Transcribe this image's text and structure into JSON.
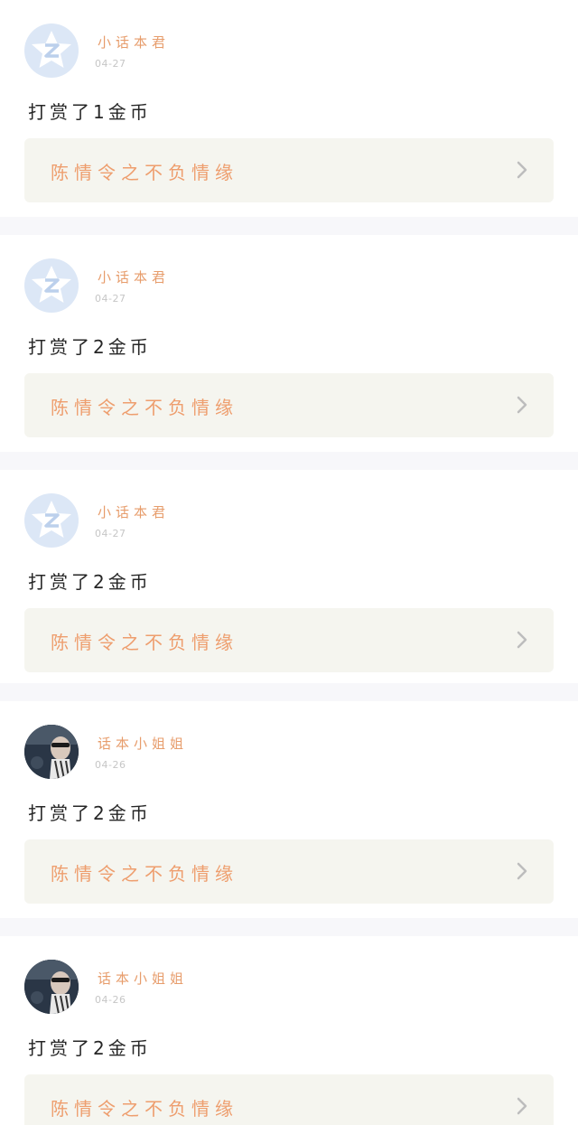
{
  "entries": [
    {
      "username": "小话本君",
      "date": "04-27",
      "message": "打赏了1金币",
      "book_title": "陈情令之不负情缘",
      "avatar_icon": "qq-default-avatar-icon"
    },
    {
      "username": "小话本君",
      "date": "04-27",
      "message": "打赏了2金币",
      "book_title": "陈情令之不负情缘",
      "avatar_icon": "qq-default-avatar-icon"
    },
    {
      "username": "小话本君",
      "date": "04-27",
      "message": "打赏了2金币",
      "book_title": "陈情令之不负情缘",
      "avatar_icon": "qq-default-avatar-icon"
    },
    {
      "username": "话本小姐姐",
      "date": "04-26",
      "message": "打赏了2金币",
      "book_title": "陈情令之不负情缘",
      "avatar_icon": "photo-avatar"
    },
    {
      "username": "话本小姐姐",
      "date": "04-26",
      "message": "打赏了2金币",
      "book_title": "陈情令之不负情缘",
      "avatar_icon": "photo-avatar"
    }
  ],
  "colors": {
    "username": "#e79d6c",
    "book_title": "#ee9e6e",
    "card_bg": "#f5f5ef",
    "divider": "#f7f7fa"
  }
}
